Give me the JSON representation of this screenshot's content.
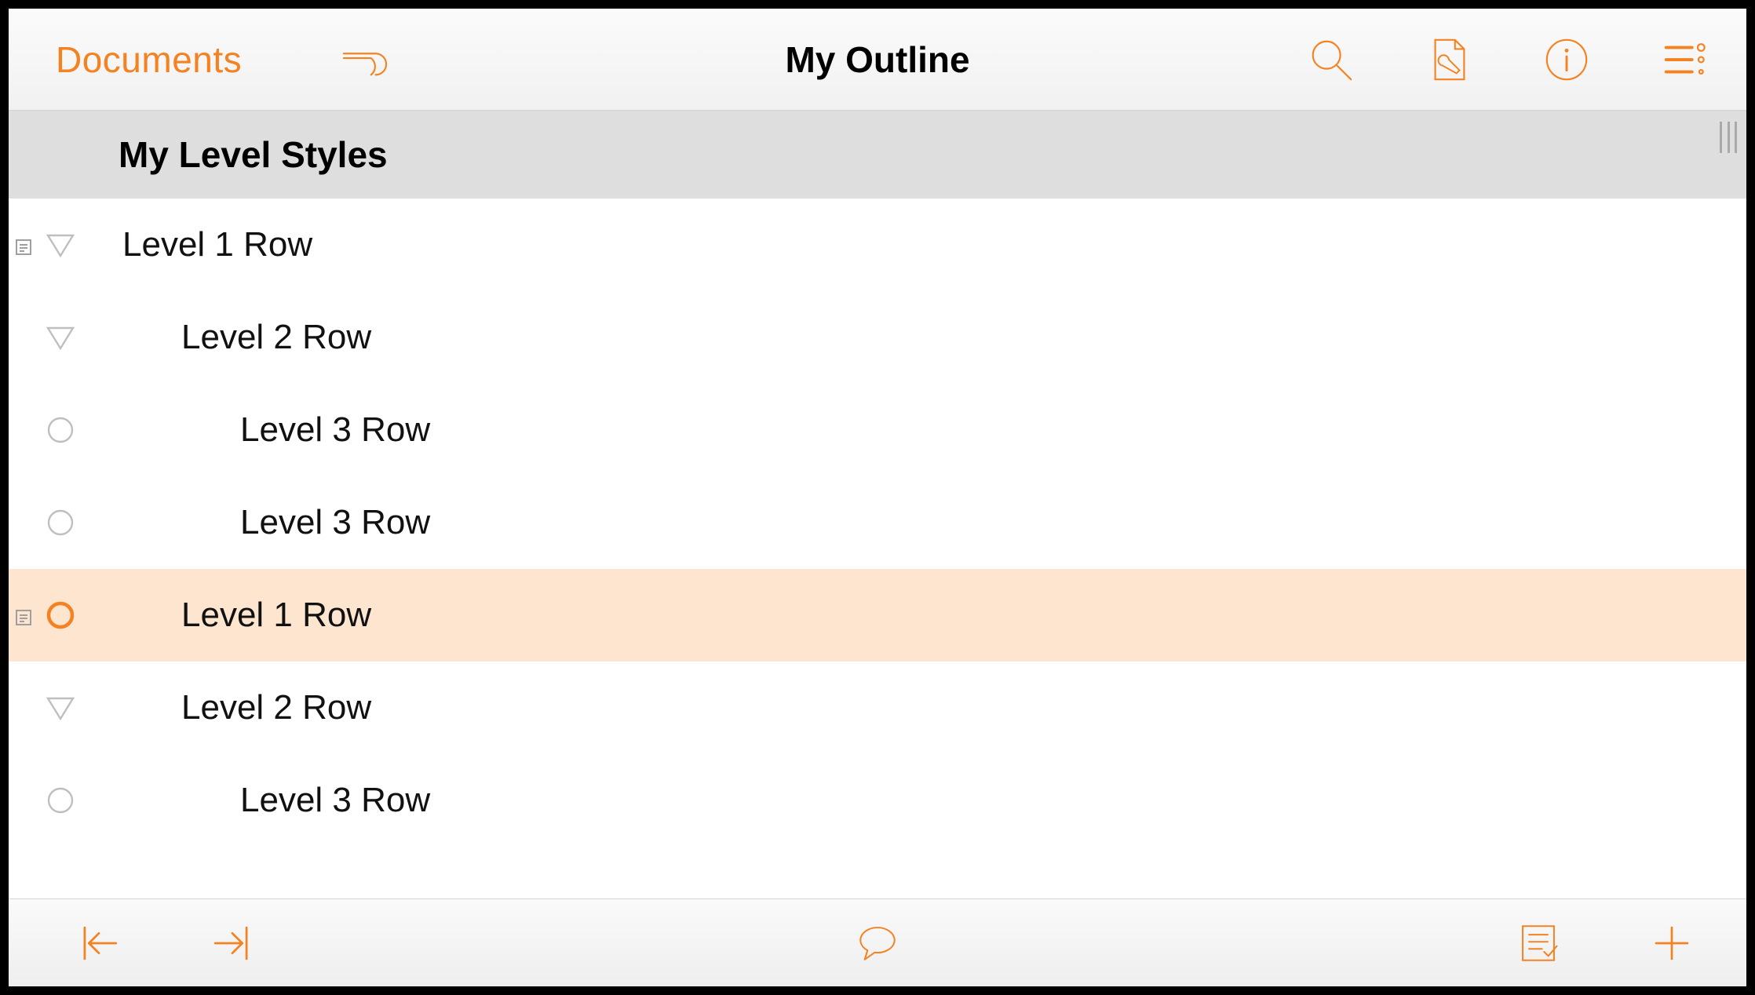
{
  "colors": {
    "accent": "#f58220",
    "highlight_bg": "#fde5cf",
    "header_bg": "#dedede"
  },
  "toolbar": {
    "documents_label": "Documents",
    "title": "My Outline",
    "icons": {
      "undo": "undo-icon",
      "search": "search-icon",
      "inspector": "wrench-document-icon",
      "info": "info-icon",
      "list_settings": "list-settings-icon"
    }
  },
  "outline": {
    "group_title": "My Level Styles",
    "rows": [
      {
        "text": "Level 1 Row",
        "level": 1,
        "handle": "triangle",
        "has_note": true,
        "selected": false
      },
      {
        "text": "Level 2 Row",
        "level": 2,
        "handle": "triangle",
        "has_note": false,
        "selected": false
      },
      {
        "text": "Level 3 Row",
        "level": 3,
        "handle": "circle",
        "has_note": false,
        "selected": false
      },
      {
        "text": "Level 3 Row",
        "level": 3,
        "handle": "circle",
        "has_note": false,
        "selected": false
      },
      {
        "text": "Level 1 Row",
        "level": 2,
        "handle": "circle",
        "has_note": true,
        "selected": true
      },
      {
        "text": "Level 2 Row",
        "level": 2,
        "handle": "triangle",
        "has_note": false,
        "selected": false
      },
      {
        "text": "Level 3 Row",
        "level": 3,
        "handle": "circle",
        "has_note": false,
        "selected": false
      }
    ]
  },
  "bottom_toolbar": {
    "icons": {
      "outdent": "outdent-icon",
      "indent": "indent-icon",
      "comment": "comment-icon",
      "note": "note-icon",
      "add": "add-icon"
    }
  }
}
